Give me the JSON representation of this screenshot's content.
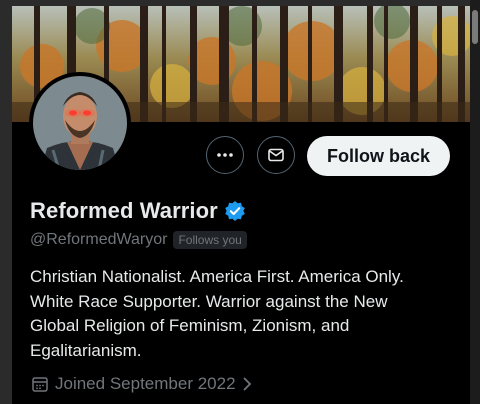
{
  "profile": {
    "display_name": "Reformed Warrior",
    "handle": "@ReformedWaryor",
    "follows_you_badge": "Follows you",
    "bio_lines": [
      "Christian Nationalist. America First. America Only.",
      "White Race Supporter. Warrior against the New",
      "Global Religion of Feminism, Zionism, and",
      "Egalitarianism."
    ],
    "joined": "Joined September 2022"
  },
  "actions": {
    "follow_back_label": "Follow back",
    "more_icon": "more-horizontal-icon",
    "message_icon": "envelope-icon"
  },
  "colors": {
    "background": "#000000",
    "verified_badge": "#1d9bf0",
    "follow_button_bg": "#eff3f4",
    "secondary_text": "#71767b"
  }
}
